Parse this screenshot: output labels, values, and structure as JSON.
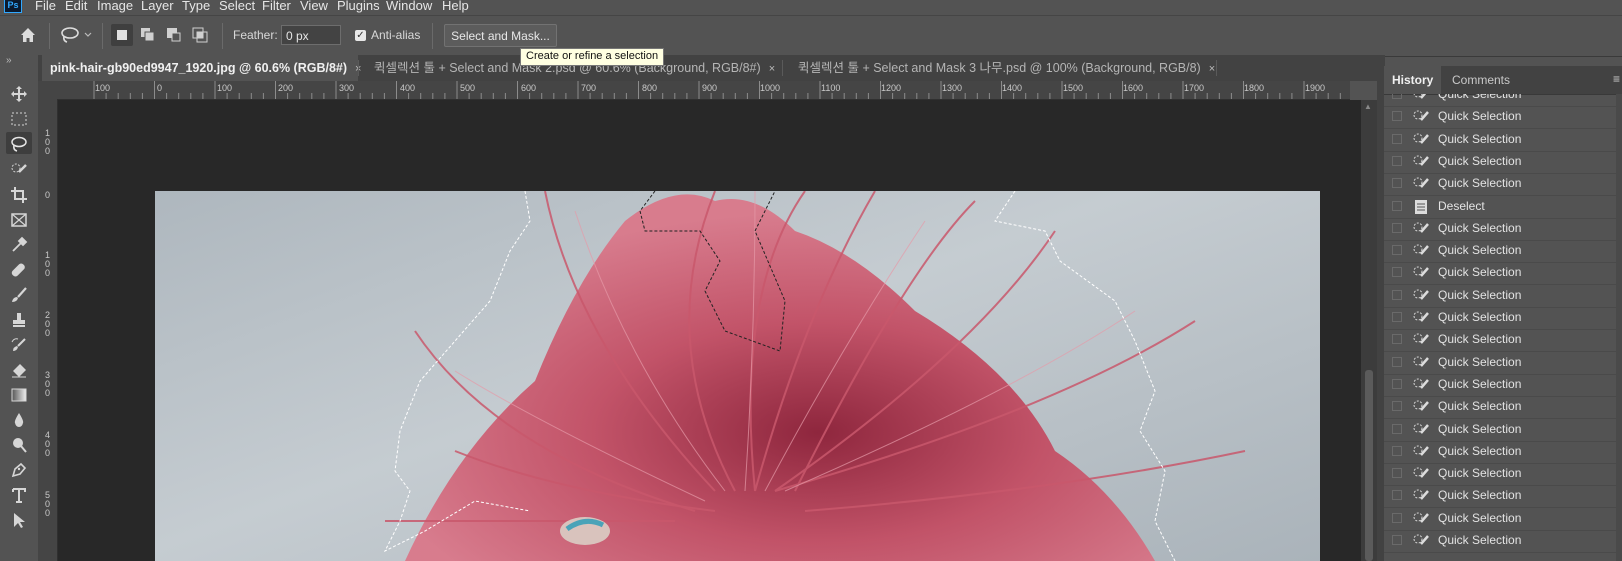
{
  "app": {
    "logo": "Ps"
  },
  "menu": [
    "File",
    "Edit",
    "Image",
    "Layer",
    "Type",
    "Select",
    "Filter",
    "View",
    "Plugins",
    "Window",
    "Help"
  ],
  "options": {
    "feather_label": "Feather:",
    "feather_value": "0 px",
    "antialias_label": "Anti-alias",
    "antialias_checked": true,
    "select_mask_label": "Select and Mask...",
    "tooltip": "Create or refine a selection"
  },
  "tabs": [
    {
      "label": "pink-hair-gb90ed9947_1920.jpg @ 60.6% (RGB/8#)",
      "active": true
    },
    {
      "label": "퀵셀렉션 툴 + Select and Mask 2.psd @ 60.6% (Background, RGB/8#)",
      "active": false
    },
    {
      "label": "퀵셀렉션 툴 + Select and Mask 3 나무.psd @ 100% (Background, RGB/8)",
      "active": false
    }
  ],
  "tab_close": "×",
  "ruler_top": [
    "100",
    "0",
    "100",
    "200",
    "300",
    "400",
    "500",
    "600",
    "700",
    "800",
    "900",
    "1000",
    "1100",
    "1200",
    "1300",
    "1400",
    "1500",
    "1600",
    "1700",
    "1800",
    "1900"
  ],
  "ruler_left": [
    "100",
    "0",
    "100",
    "200",
    "300",
    "400",
    "500"
  ],
  "panel": {
    "tabs": [
      "History",
      "Comments"
    ],
    "menu_icon": "≡"
  },
  "history": [
    {
      "label": "Quick Selection",
      "icon": "quick-selection-icon"
    },
    {
      "label": "Quick Selection",
      "icon": "quick-selection-icon"
    },
    {
      "label": "Quick Selection",
      "icon": "quick-selection-icon"
    },
    {
      "label": "Quick Selection",
      "icon": "quick-selection-icon"
    },
    {
      "label": "Quick Selection",
      "icon": "quick-selection-icon"
    },
    {
      "label": "Deselect",
      "icon": "deselect-icon"
    },
    {
      "label": "Quick Selection",
      "icon": "quick-selection-icon"
    },
    {
      "label": "Quick Selection",
      "icon": "quick-selection-icon"
    },
    {
      "label": "Quick Selection",
      "icon": "quick-selection-icon"
    },
    {
      "label": "Quick Selection",
      "icon": "quick-selection-icon"
    },
    {
      "label": "Quick Selection",
      "icon": "quick-selection-icon"
    },
    {
      "label": "Quick Selection",
      "icon": "quick-selection-icon"
    },
    {
      "label": "Quick Selection",
      "icon": "quick-selection-icon"
    },
    {
      "label": "Quick Selection",
      "icon": "quick-selection-icon"
    },
    {
      "label": "Quick Selection",
      "icon": "quick-selection-icon"
    },
    {
      "label": "Quick Selection",
      "icon": "quick-selection-icon"
    },
    {
      "label": "Quick Selection",
      "icon": "quick-selection-icon"
    },
    {
      "label": "Quick Selection",
      "icon": "quick-selection-icon"
    },
    {
      "label": "Quick Selection",
      "icon": "quick-selection-icon"
    },
    {
      "label": "Quick Selection",
      "icon": "quick-selection-icon"
    },
    {
      "label": "Quick Selection",
      "icon": "quick-selection-icon"
    }
  ],
  "colors": {
    "accent": "#31a8ff",
    "hair": "#c5546a",
    "background": "#b8c0c6"
  }
}
